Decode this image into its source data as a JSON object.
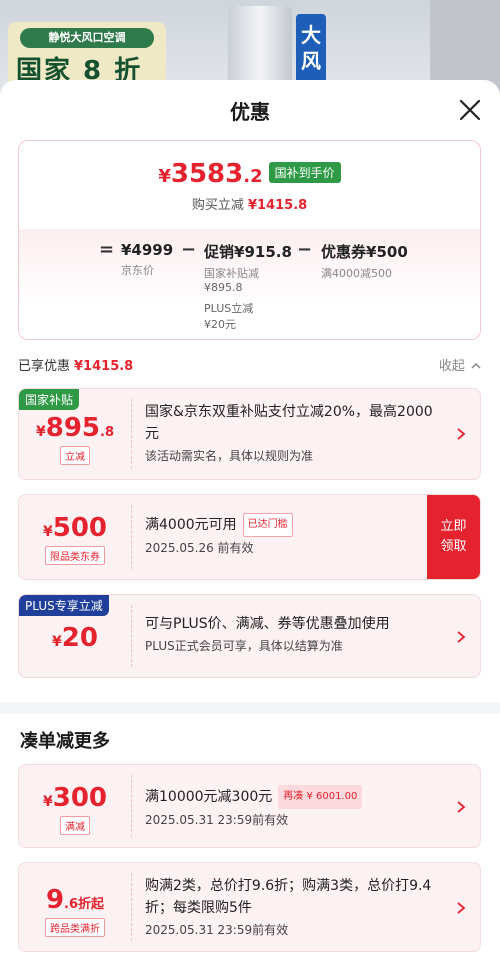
{
  "background": {
    "banner_tag": "静悦大风口空调",
    "banner_big": "国家 8 折",
    "banner_blue": "大风"
  },
  "sheet": {
    "title": "优惠"
  },
  "summary": {
    "currency": "¥",
    "price_int": "3583",
    "price_dec": ".2",
    "badge": "国补到手价",
    "instant_label": "购买立减",
    "instant_value": "¥1415.8",
    "formula": {
      "equals": "=",
      "base_value": "¥4999",
      "base_label": "京东价",
      "minus1": "−",
      "promo_label": "促销",
      "promo_value": "¥915.8",
      "promo_sub1_label": "国家补贴减",
      "promo_sub1_value": "¥895.8",
      "promo_sub2_label": "PLUS立减",
      "promo_sub2_value": "¥20元",
      "minus2": "−",
      "coupon_label": "优惠券",
      "coupon_value": "¥500",
      "coupon_sub": "满4000减500"
    }
  },
  "enjoyed": {
    "label": "已享优惠",
    "value": "¥1415.8",
    "collapse": "收起"
  },
  "cards": [
    {
      "corner": "国家补贴",
      "currency": "¥",
      "amount": "895",
      "decimal": ".8",
      "tag": "立减",
      "text": "国家&京东双重补贴支付立减20%，最高2000元",
      "note": "该活动需实名，具体以规则为准"
    },
    {
      "currency": "¥",
      "amount": "500",
      "tag": "限品类东券",
      "text": "满4000元可用",
      "badge": "已达门槛",
      "date": "2025.05.26 前有效",
      "action": "立即领取"
    },
    {
      "corner": "PLUS专享立减",
      "currency": "¥",
      "amount": "20",
      "text": "可与PLUS价、满减、券等优惠叠加使用",
      "note": "PLUS正式会员可享，具体以结算为准"
    }
  ],
  "more_section": {
    "title": "凑单减更多"
  },
  "more_cards": [
    {
      "currency": "¥",
      "amount": "300",
      "tag": "满减",
      "text": "满10000元减300元",
      "badge": "再凑 ¥ 6001.00",
      "date": "2025.05.31  23:59前有效"
    },
    {
      "amount": "9",
      "decimal": ".6",
      "unit": "折起",
      "tag": "跨品类满折",
      "text": "购满2类，总价打9.6折；购满3类，总价打9.4折；每类限购5件",
      "date": "2025.05.31  23:59前有效"
    }
  ],
  "colors": {
    "accent": "#e4232f",
    "green_badge": "#2f9a45",
    "plus_corner": "#1f3f9a"
  }
}
